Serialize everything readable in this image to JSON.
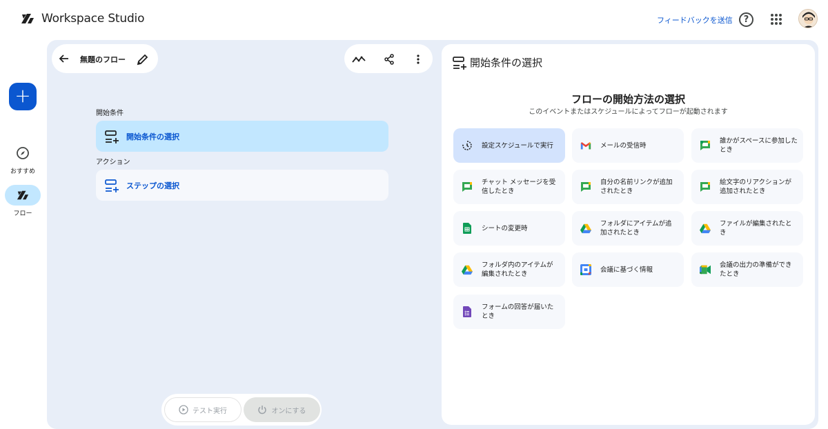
{
  "app": {
    "title": "Workspace Studio"
  },
  "header": {
    "feedback_label": "フィードバックを送信",
    "help_symbol": "?"
  },
  "rail": {
    "new_symbol": "+",
    "items": [
      {
        "label": "おすすめ",
        "icon": "compass-icon"
      },
      {
        "label": "フロー",
        "icon": "flow-icon",
        "active": true
      }
    ]
  },
  "editor": {
    "flow_title": "無題のフロー",
    "trigger_section_label": "開始条件",
    "trigger_card_label": "開始条件の選択",
    "action_section_label": "アクション",
    "action_card_label": "ステップの選択",
    "test_button_label": "テスト実行",
    "turn_on_button_label": "オンにする"
  },
  "panel": {
    "title": "開始条件の選択",
    "heading": "フローの開始方法の選択",
    "subheading": "このイベントまたはスケジュールによってフローが起動されます",
    "triggers": [
      {
        "label": "設定スケジュールで実行",
        "icon": "schedule-icon",
        "selected": true
      },
      {
        "label": "メールの受信時",
        "icon": "gmail-icon"
      },
      {
        "label": "誰かがスペースに参加したとき",
        "icon": "chat-icon"
      },
      {
        "label": "チャット メッセージを受信したとき",
        "icon": "chat-icon"
      },
      {
        "label": "自分の名前リンクが追加されたとき",
        "icon": "chat-icon"
      },
      {
        "label": "絵文字のリアクションが追加されたとき",
        "icon": "chat-icon"
      },
      {
        "label": "シートの変更時",
        "icon": "sheets-icon"
      },
      {
        "label": "フォルダにアイテムが追加されたとき",
        "icon": "drive-icon"
      },
      {
        "label": "ファイルが編集されたとき",
        "icon": "drive-icon"
      },
      {
        "label": "フォルダ内のアイテムが編集されたとき",
        "icon": "drive-icon"
      },
      {
        "label": "会議に基づく情報",
        "icon": "calendar-icon"
      },
      {
        "label": "会議の出力の準備ができたとき",
        "icon": "meet-icon"
      },
      {
        "label": "フォームの回答が届いたとき",
        "icon": "forms-icon"
      }
    ]
  },
  "colors": {
    "accent": "#0b57d0",
    "selected": "#c2e7ff",
    "editor_bg": "#e8eef8"
  }
}
